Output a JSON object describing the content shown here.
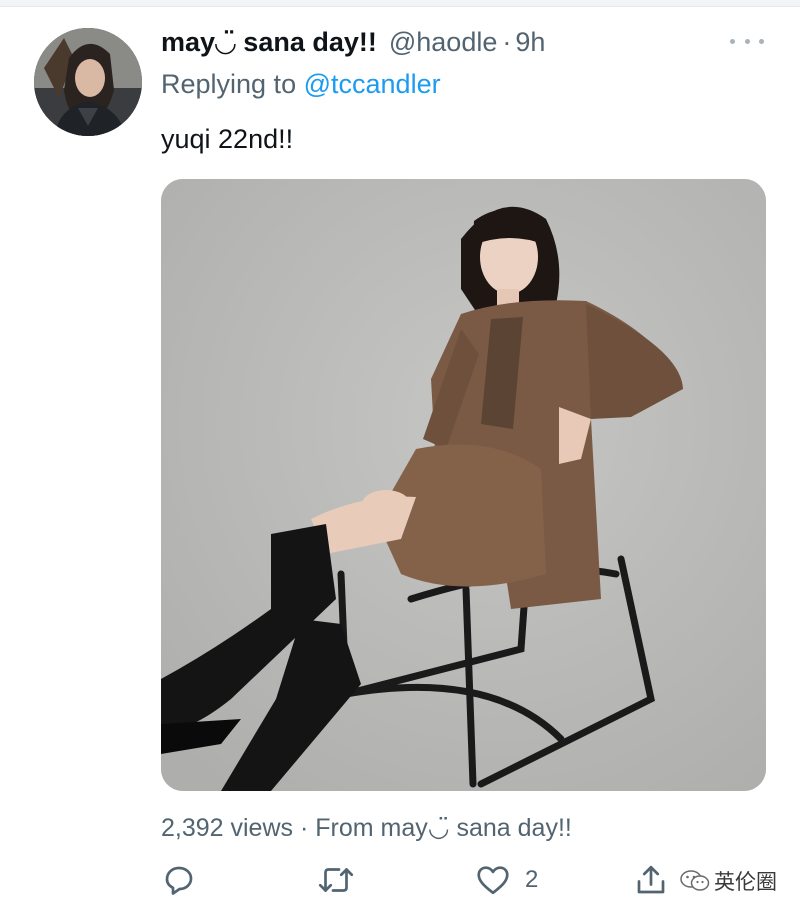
{
  "tweet": {
    "display_name": "may◡̈ sana day!!",
    "handle": "@haodle",
    "separator": "·",
    "time": "9h",
    "replying_prefix": "Replying to",
    "replying_to": "@tccandler",
    "text": "yuqi 22nd!!",
    "views_meta": "2,392 views · From may◡̈ sana day!!"
  },
  "actions": {
    "reply_icon": "reply-icon",
    "retweet_icon": "retweet-icon",
    "like_icon": "heart-icon",
    "like_count": "2",
    "share_icon": "share-icon"
  },
  "watermark": {
    "logo": "wechat-icon",
    "text": "英伦圈"
  },
  "colors": {
    "text_primary": "#0f1419",
    "text_secondary": "#536471",
    "link": "#1d9bf0",
    "photo_backdrop": "#bbbab8"
  }
}
